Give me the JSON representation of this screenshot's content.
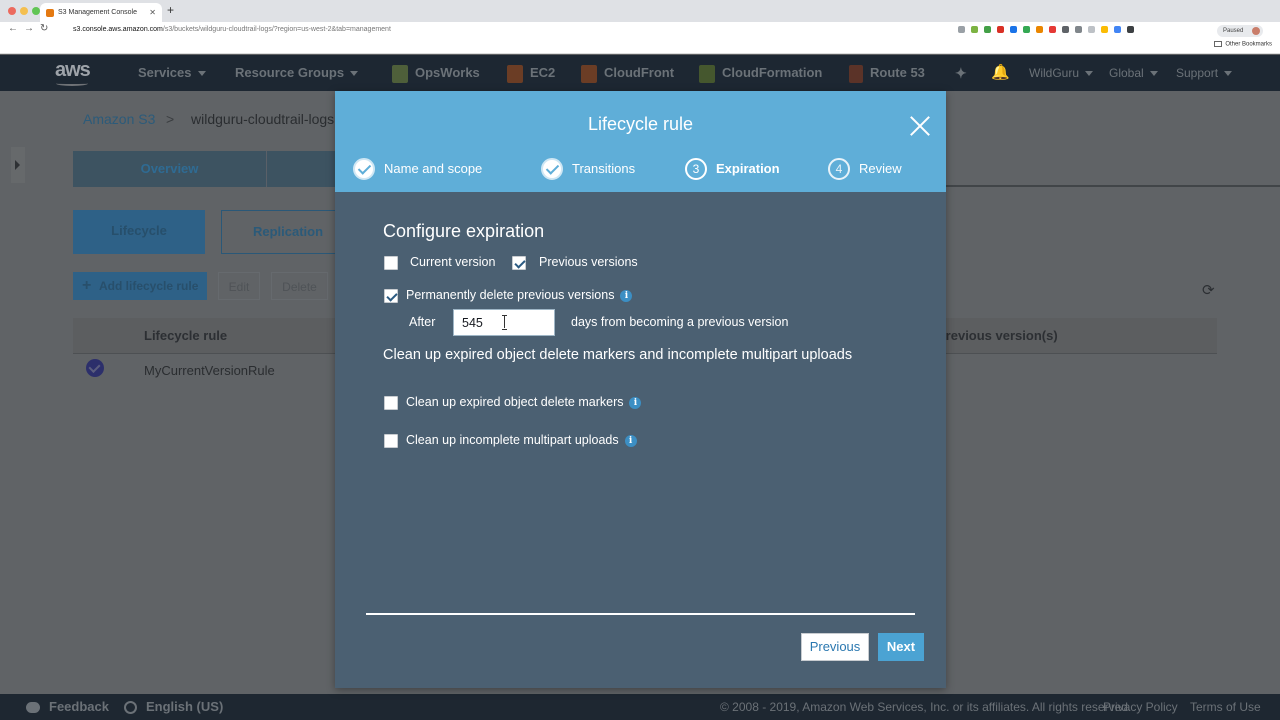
{
  "browser": {
    "tab_title": "S3 Management Console",
    "url_domain": "s3.console.aws.amazon.com",
    "url_path": "/s3/buckets/wildguru-cloudtrail-logs/?region=us-west-2&tab=management",
    "paused_label": "Paused",
    "bookmarks_label": "Other Bookmarks"
  },
  "navbar": {
    "logo": "aws",
    "services": "Services",
    "resource_groups": "Resource Groups",
    "opsworks": "OpsWorks",
    "ec2": "EC2",
    "cloudfront": "CloudFront",
    "cloudformation": "CloudFormation",
    "route53": "Route 53",
    "account": "WildGuru",
    "region": "Global",
    "support": "Support"
  },
  "page": {
    "breadcrumb_root": "Amazon S3",
    "breadcrumb_sep": ">",
    "breadcrumb_bucket": "wildguru-cloudtrail-logs",
    "tab_overview": "Overview",
    "pill_lifecycle": "Lifecycle",
    "pill_replication": "Replication",
    "add_rule": "Add lifecycle rule",
    "edit": "Edit",
    "delete": "Delete",
    "col_rule": "Lifecycle rule",
    "col_prev": "Previous version(s)",
    "row_rule_name": "MyCurrentVersionRule"
  },
  "modal": {
    "title": "Lifecycle rule",
    "steps": [
      {
        "label": "Name and scope",
        "num": "1",
        "state": "done"
      },
      {
        "label": "Transitions",
        "num": "2",
        "state": "done"
      },
      {
        "label": "Expiration",
        "num": "3",
        "state": "current"
      },
      {
        "label": "Review",
        "num": "4",
        "state": "future"
      }
    ],
    "configure_title": "Configure expiration",
    "current_version": "Current version",
    "current_version_checked": false,
    "previous_versions": "Previous versions",
    "previous_versions_checked": true,
    "perm_delete": "Permanently delete previous versions",
    "perm_delete_checked": true,
    "after_label": "After",
    "days_value": "545",
    "days_suffix": "days from becoming a previous version",
    "cleanup_title": "Clean up expired object delete markers and incomplete multipart uploads",
    "cleanup_markers": "Clean up expired object delete markers",
    "cleanup_markers_checked": false,
    "cleanup_multipart": "Clean up incomplete multipart uploads",
    "cleanup_multipart_checked": false,
    "btn_previous": "Previous",
    "btn_next": "Next"
  },
  "footer": {
    "feedback": "Feedback",
    "language": "English (US)",
    "copyright": "© 2008 - 2019, Amazon Web Services, Inc. or its affiliates. All rights reserved.",
    "privacy": "Privacy Policy",
    "terms": "Terms of Use"
  },
  "colors": {
    "modal_header": "#5faed8",
    "modal_body": "#4b6072",
    "aws_nav": "#1d2732",
    "primary_button": "#4ba3d3"
  }
}
